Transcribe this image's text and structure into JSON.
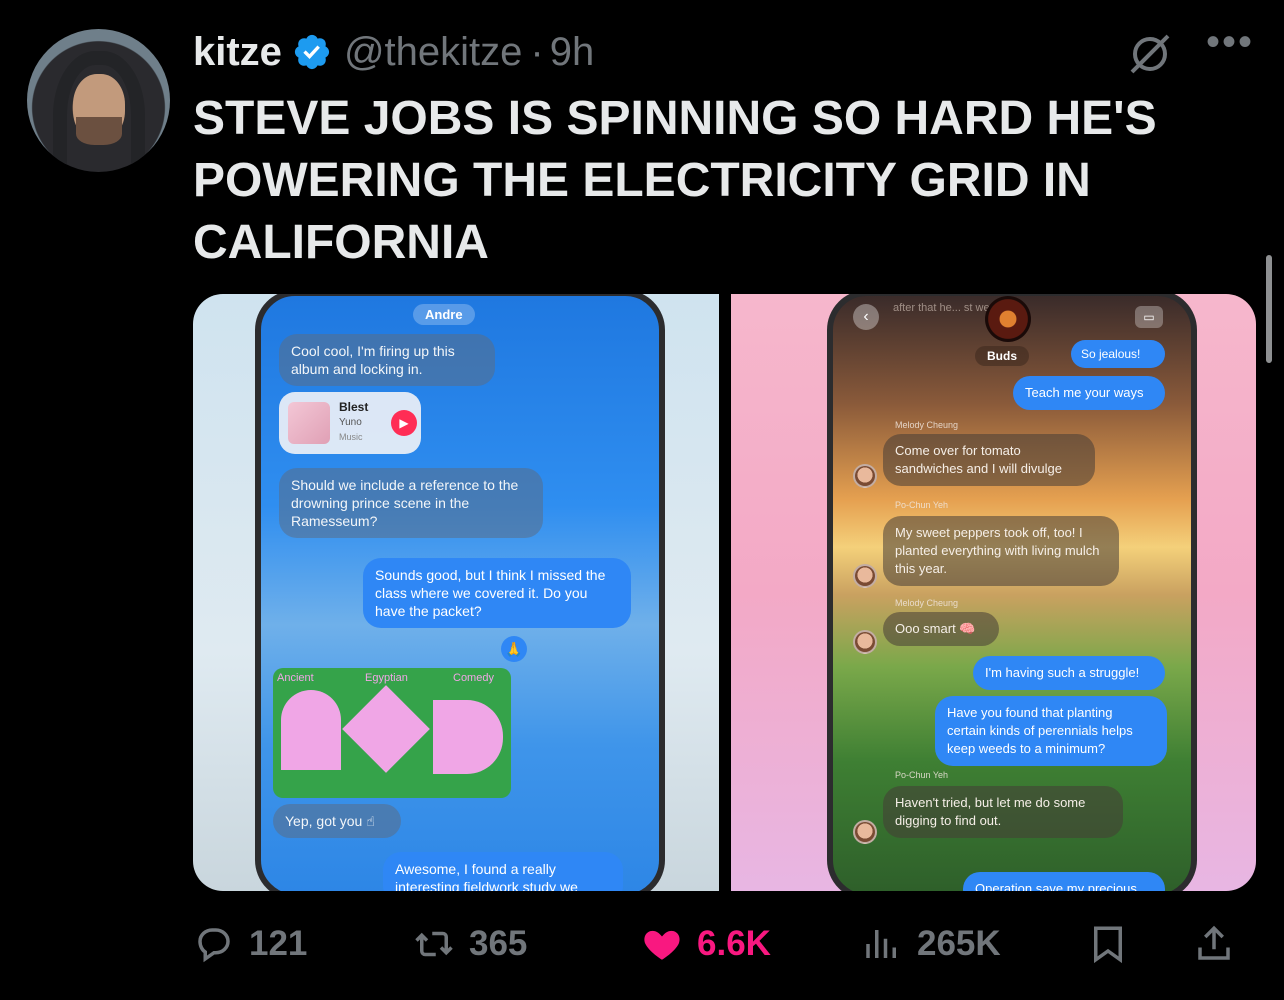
{
  "author": {
    "name": "kitze",
    "handle": "@thekitze",
    "separator": "·",
    "time": "9h"
  },
  "tweet": {
    "text": "STEVE JOBS IS SPINNING SO HARD HE'S\nPOWERING THE ELECTRICITY GRID IN\nCALIFORNIA"
  },
  "icons": {
    "verified": "verified-badge-icon",
    "grok": "grok-icon",
    "more": "more-icon",
    "reply": "reply-icon",
    "retweet": "retweet-icon",
    "like": "heart-icon",
    "views": "views-icon",
    "bookmark": "bookmark-icon",
    "share": "share-icon"
  },
  "colors": {
    "background": "#000000",
    "muted": "#71767b",
    "like": "#f91880",
    "verified": "#1d9bf0"
  },
  "media_left": {
    "contact": "Andre",
    "messages": [
      "Cool cool, I'm firing up this album and locking in.",
      "Should we include a reference to the drowning prince scene in the Ramesseum?",
      "Sounds good, but I think I missed the class where we covered it. Do you have the packet?",
      "Yep, got you ☝",
      "Awesome, I found a really interesting fieldwork study we"
    ],
    "music": {
      "title": "Blest",
      "artist": "Yuno",
      "service": "Music"
    },
    "poster": {
      "w1": "Ancient",
      "w2": "Egyptian",
      "w3": "Comedy"
    }
  },
  "media_right": {
    "contact": "Buds",
    "top_text": "after that he... st week",
    "messages": [
      "So jealous!",
      "Teach me your ways",
      "Come over for tomato sandwiches and I will divulge",
      "My sweet peppers took off, too! I planted everything with living mulch this year.",
      "Ooo smart 🧠",
      "I'm having such a struggle!",
      "Have you found that planting certain kinds of perennials helps keep weeds to a minimum?",
      "Haven't tried, but let me do some digging to find out.",
      "Operation save my precious"
    ],
    "labels": [
      "Melody Cheung",
      "Po-Chun Yeh",
      "Melody Cheung",
      "Po-Chun Yeh"
    ]
  },
  "actions": {
    "replies": "121",
    "retweets": "365",
    "likes": "6.6K",
    "views": "265K"
  }
}
